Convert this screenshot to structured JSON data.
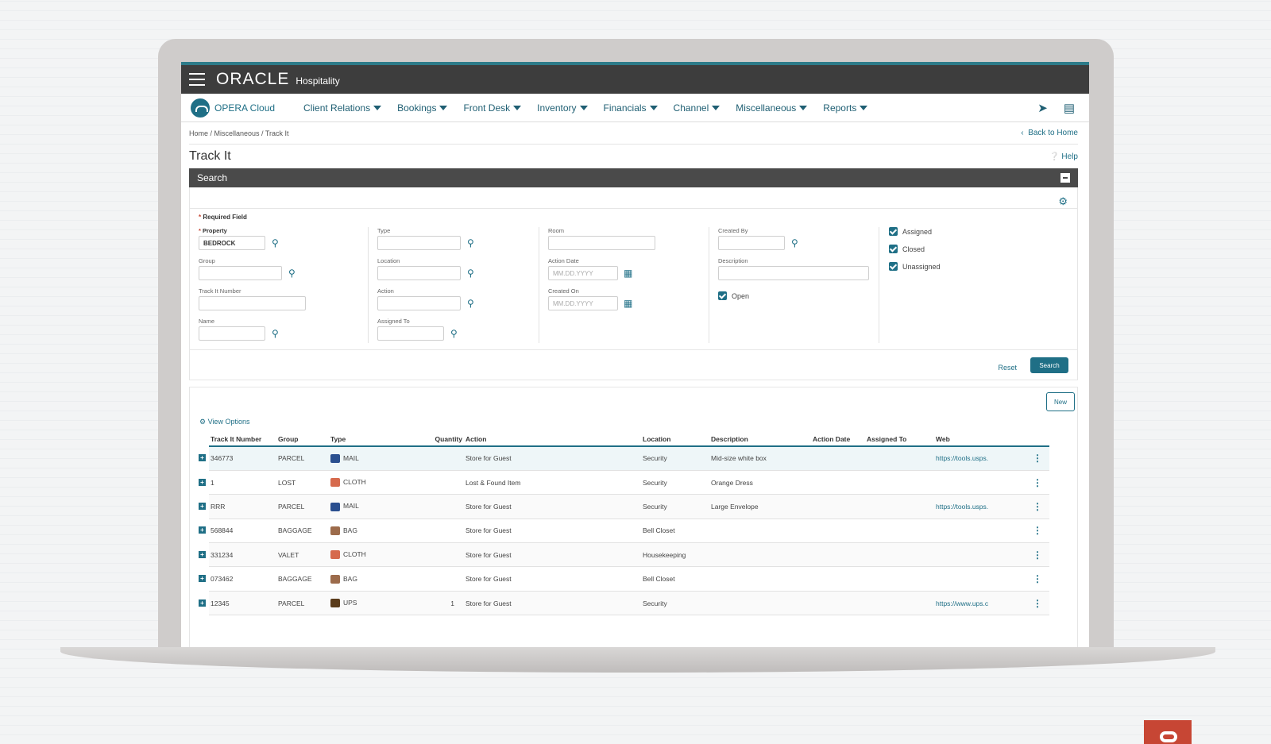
{
  "header": {
    "brand": "ORACLE",
    "brand_suffix": "Hospitality"
  },
  "nav": {
    "product": "OPERA Cloud",
    "items": [
      "Client Relations",
      "Bookings",
      "Front Desk",
      "Inventory",
      "Financials",
      "Channel",
      "Miscellaneous",
      "Reports"
    ]
  },
  "breadcrumb": "Home / Miscellaneous / Track It",
  "back_link": "Back to Home",
  "page_title": "Track It",
  "help": "Help",
  "search": {
    "title": "Search",
    "required_note": "Required Field",
    "fields": {
      "property": {
        "label": "Property",
        "value": "BEDROCK"
      },
      "group": {
        "label": "Group"
      },
      "track_it_number": {
        "label": "Track It Number"
      },
      "name": {
        "label": "Name"
      },
      "type": {
        "label": "Type"
      },
      "location": {
        "label": "Location"
      },
      "action": {
        "label": "Action"
      },
      "assigned_to": {
        "label": "Assigned To"
      },
      "room": {
        "label": "Room"
      },
      "action_date": {
        "label": "Action Date",
        "placeholder": "MM.DD.YYYY"
      },
      "created_on": {
        "label": "Created On",
        "placeholder": "MM.DD.YYYY"
      },
      "created_by": {
        "label": "Created By"
      },
      "description": {
        "label": "Description"
      }
    },
    "checkboxes": {
      "open": "Open",
      "assigned": "Assigned",
      "closed": "Closed",
      "unassigned": "Unassigned"
    },
    "reset": "Reset",
    "search_button": "Search"
  },
  "results": {
    "new_button": "New",
    "view_options": "View Options",
    "columns": [
      "Track It Number",
      "Group",
      "Type",
      "Quantity",
      "Action",
      "Location",
      "Description",
      "Action Date",
      "Assigned To",
      "Web"
    ],
    "rows": [
      {
        "number": "346773",
        "group": "PARCEL",
        "type": "MAIL",
        "type_icon": "mail-icon",
        "quantity": "",
        "action": "Store for Guest",
        "location": "Security",
        "description": "Mid-size white box",
        "action_date": "",
        "assigned_to": "",
        "web": "https://tools.usps."
      },
      {
        "number": "1",
        "group": "LOST",
        "type": "CLOTH",
        "type_icon": "cloth-icon",
        "quantity": "",
        "action": "Lost & Found Item",
        "location": "Security",
        "description": "Orange Dress",
        "action_date": "",
        "assigned_to": "",
        "web": ""
      },
      {
        "number": "RRR",
        "group": "PARCEL",
        "type": "MAIL",
        "type_icon": "mail-icon",
        "quantity": "",
        "action": "Store for Guest",
        "location": "Security",
        "description": "Large Envelope",
        "action_date": "",
        "assigned_to": "",
        "web": "https://tools.usps."
      },
      {
        "number": "568844",
        "group": "BAGGAGE",
        "type": "BAG",
        "type_icon": "bag-icon",
        "quantity": "",
        "action": "Store for Guest",
        "location": "Bell Closet",
        "description": "",
        "action_date": "",
        "assigned_to": "",
        "web": ""
      },
      {
        "number": "331234",
        "group": "VALET",
        "type": "CLOTH",
        "type_icon": "cloth-icon",
        "quantity": "",
        "action": "Store for Guest",
        "location": "Housekeeping",
        "description": "",
        "action_date": "",
        "assigned_to": "",
        "web": ""
      },
      {
        "number": "073462",
        "group": "BAGGAGE",
        "type": "BAG",
        "type_icon": "bag-icon",
        "quantity": "",
        "action": "Store for Guest",
        "location": "Bell Closet",
        "description": "",
        "action_date": "",
        "assigned_to": "",
        "web": ""
      },
      {
        "number": "12345",
        "group": "PARCEL",
        "type": "UPS",
        "type_icon": "ups-icon",
        "quantity": "1",
        "action": "Store for Guest",
        "location": "Security",
        "description": "",
        "action_date": "",
        "assigned_to": "",
        "web": "https://www.ups.c"
      }
    ]
  },
  "colors": {
    "accent": "#1f6f86",
    "header": "#3d3d3d",
    "search_bar": "#4a4a4a",
    "oracle_red": "#c74634"
  }
}
